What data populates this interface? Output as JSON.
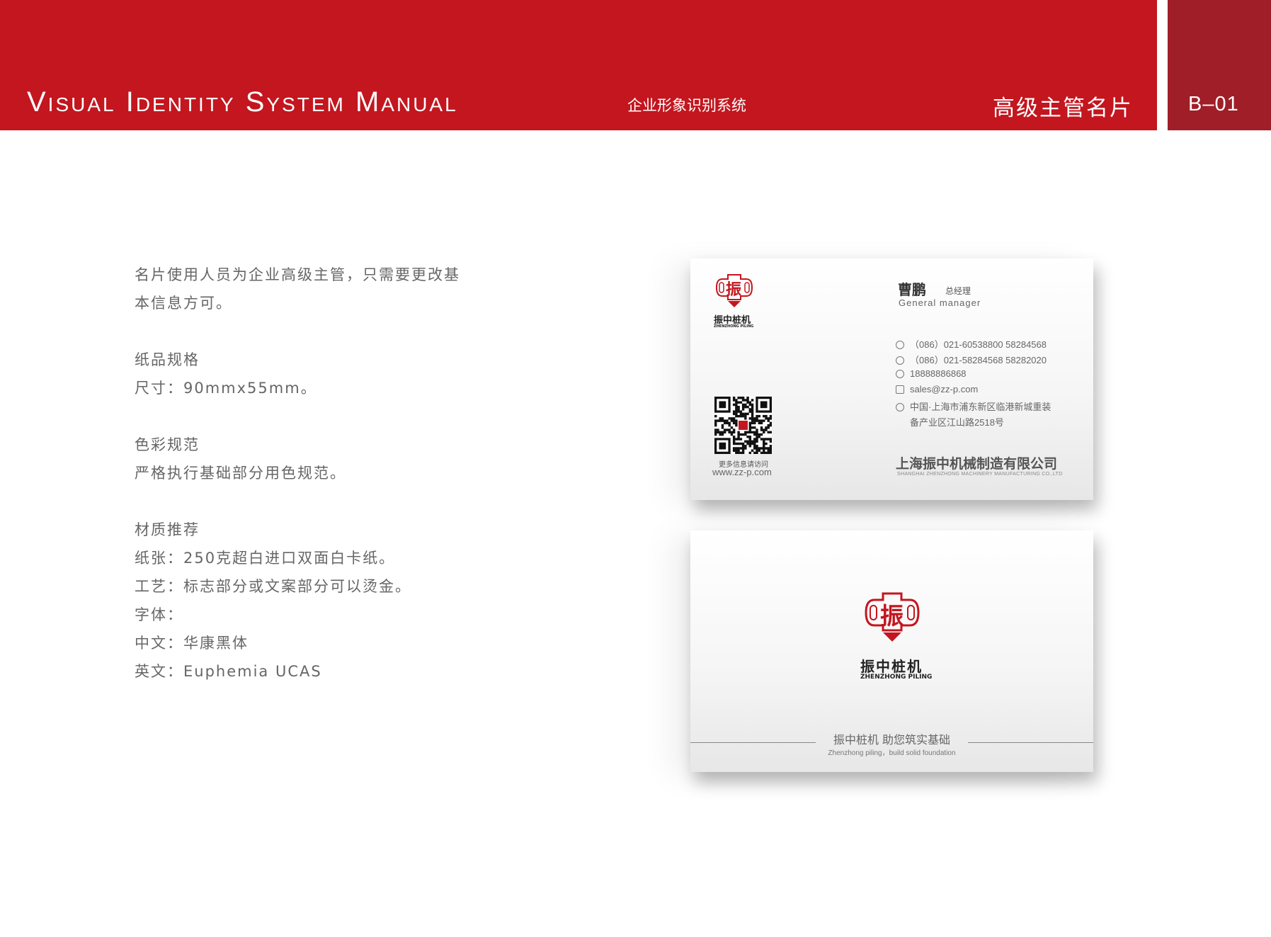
{
  "header": {
    "title": "Visual Identity System Manual",
    "subtitle": "企业形象识别系统",
    "section": "高级主管名片",
    "code": "B–01"
  },
  "description": {
    "intro_1": "名片使用人员为企业高级主管，只需要更改基",
    "intro_2": "本信息方可。",
    "paper_title": "纸品规格",
    "paper_size": "尺寸：90mmx55mm。",
    "color_title": "色彩规范",
    "color_rule": "严格执行基础部分用色规范。",
    "material_title": "材质推荐",
    "material_paper": "纸张：250克超白进口双面白卡纸。",
    "material_craft": "工艺：标志部分或文案部分可以烫金。",
    "font_title": "字体：",
    "font_cn": "中文：华康黑体",
    "font_en": "英文：Euphemia UCAS"
  },
  "card_front": {
    "logo_char": "振",
    "logo_cn": "振中桩机",
    "logo_en": "ZHENZHONG PILING",
    "name": "曹鹏",
    "role": "总经理",
    "role_en": "General manager",
    "phone": "（086）021-60538800  58284568",
    "fax": "（086）021-58284568  58282020",
    "mobile": "18888886868",
    "email": "sales@zz-p.com",
    "address_1": "中国·上海市浦东新区临港新城重装",
    "address_2": "备产业区江山路2518号",
    "qr_caption": "更多信息请访问",
    "website": "www.zz-p.com",
    "company": "上海振中机械制造有限公司",
    "company_en": "SHANGHAI ZHENZHONG MACHINERY MANUFACTURING CO.,LTD",
    "icons": [
      "phone-icon",
      "fax-icon",
      "mobile-icon",
      "email-icon",
      "location-icon"
    ]
  },
  "card_back": {
    "logo_char": "振",
    "logo_cn": "振中桩机",
    "logo_en": "ZHENZHONG PILING",
    "slogan": "振中桩机  助您筑实基础",
    "slogan_en": "Zhenzhong piling，build solid foundation"
  },
  "colors": {
    "brand_red": "#c3161f",
    "brand_dark_red": "#a01e28"
  }
}
